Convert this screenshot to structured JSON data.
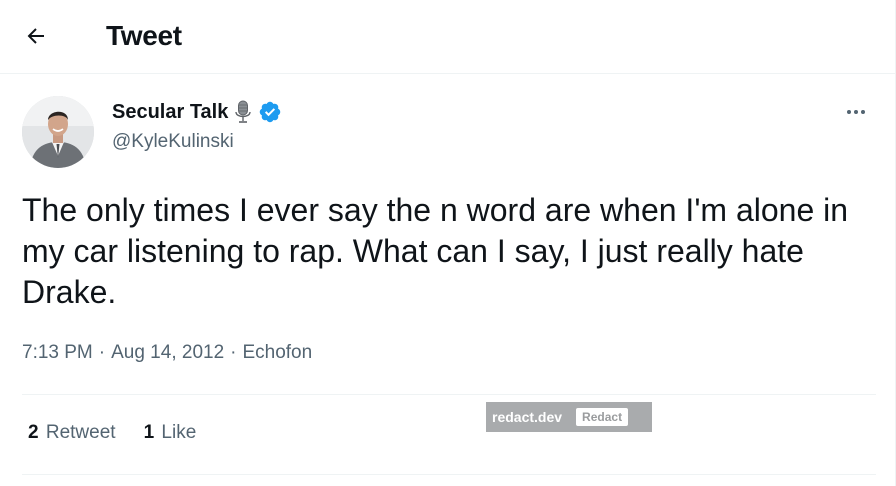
{
  "header": {
    "title": "Tweet",
    "back_icon": "arrow-left-icon"
  },
  "author": {
    "display_name": "Secular Talk",
    "handle": "@KyleKulinski",
    "badges": [
      "microphone-icon",
      "verified-badge-icon"
    ],
    "verified_color": "#1d9bf0"
  },
  "tweet": {
    "text": "The only times I ever say the n word are when I'm alone in my car listening to rap. What can I say, I just really hate Drake.",
    "time": "7:13 PM",
    "date": "Aug 14, 2012",
    "source": "Echofon",
    "separator": "·"
  },
  "stats": {
    "retweet_count": "2",
    "retweet_label": "Retweet",
    "like_count": "1",
    "like_label": "Like"
  },
  "watermark": {
    "site": "redact.dev",
    "badge": "Redact"
  }
}
